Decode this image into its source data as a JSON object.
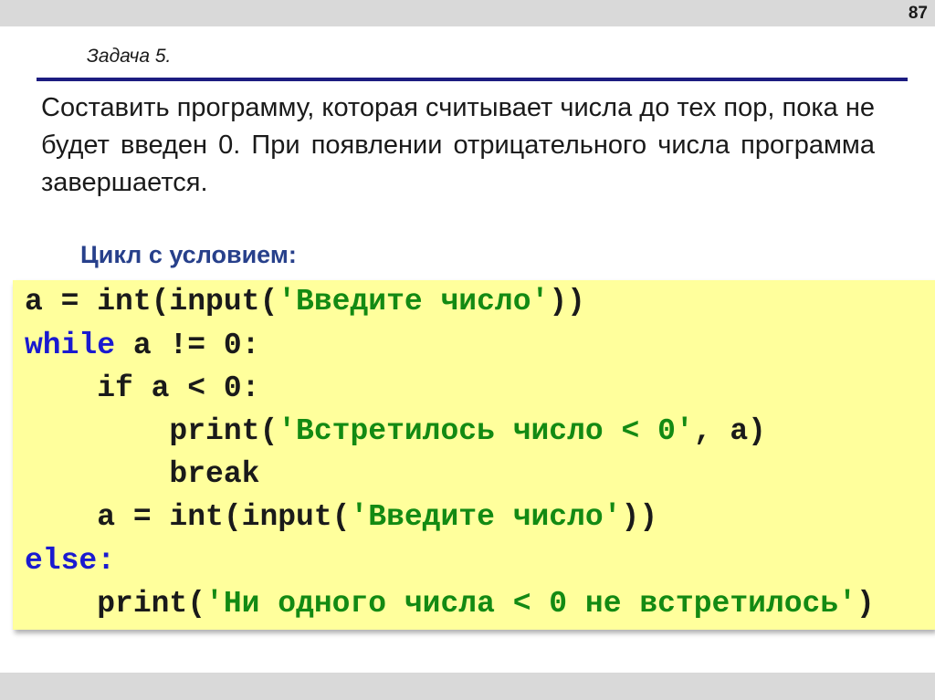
{
  "page_number": "87",
  "task_title": "Задача 5.",
  "task_text": "Составить программу, которая считывает числа до тех пор, пока не будет введен 0. При появлении отрицательного числа программа завершается.",
  "subheading": "Цикл с условием:",
  "code": {
    "l1a": "a = int(input(",
    "l1s": "'Введите число'",
    "l1b": "))",
    "l2k": "while",
    "l2b": " a != 0:",
    "l3": "    if a < 0:",
    "l4a": "        print(",
    "l4s": "'Встретилось число < 0'",
    "l4b": ", a)",
    "l5": "        break",
    "l6a": "    a = int(input(",
    "l6s": "'Введите число'",
    "l6b": "))",
    "l7k": "else:",
    "l8a": "    print(",
    "l8s": "'Ни одного числа < 0 не встретилось'",
    "l8b": ")"
  },
  "colors": {
    "keyword": "#1a1ad0",
    "string": "#138a13",
    "code_bg": "#ffff9c",
    "rule": "#1c1c80"
  }
}
